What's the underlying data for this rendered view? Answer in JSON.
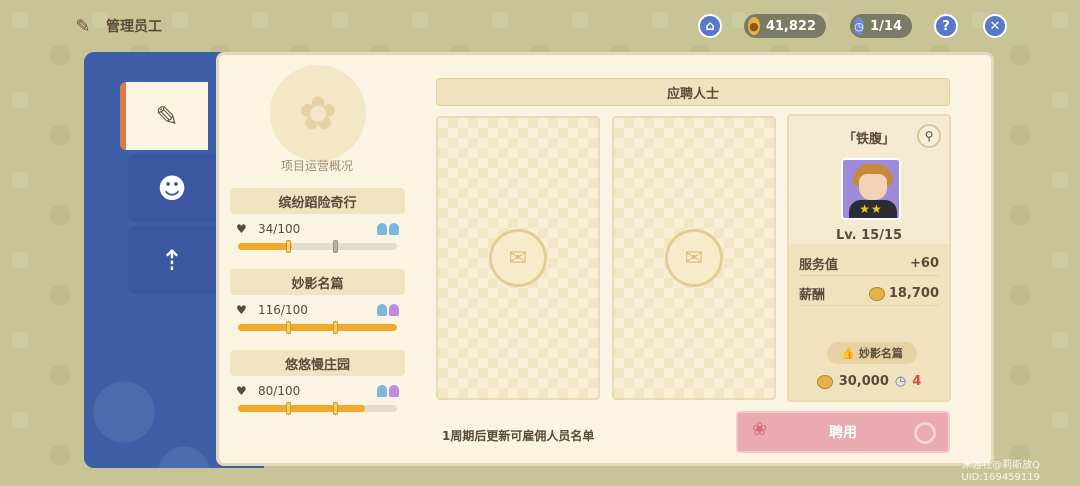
{
  "header": {
    "title": "管理员工",
    "coins": "41,822",
    "count": "1/14",
    "help_icon": "question-icon",
    "close_icon": "close-icon"
  },
  "sidebar": {
    "tabs": [
      "manage-icon",
      "staff-icon",
      "upgrade-icon"
    ]
  },
  "overview": {
    "label": "项目运营概况",
    "projects": [
      {
        "title": "缤纷蹈险奇行",
        "value": "34/100",
        "progress": 0.34
      },
      {
        "title": "妙影名篇",
        "value": "116/100",
        "progress": 1.0
      },
      {
        "title": "悠悠慢庄园",
        "value": "80/100",
        "progress": 0.8
      }
    ]
  },
  "applicants": {
    "banner": "应聘人士",
    "footer": "1周期后更新可雇佣人员名单",
    "hire_label": "聘用"
  },
  "candidate": {
    "name": "「铁腹」",
    "level": "Lv. 15/15",
    "stars": "★★",
    "service_label": "服务值",
    "service_value": "+60",
    "salary_label": "薪酬",
    "salary_value": "18,700",
    "tag": "妙影名篇",
    "cost": "30,000",
    "cost_count": "4"
  },
  "watermark": {
    "line1": "米游社@莉斯放Q",
    "line2": "UID:169459119"
  },
  "colors": {
    "background": "#c7c596",
    "panel": "#fbf4e2",
    "frame_blue": "#3e5fa8",
    "progress": "#f0a928",
    "hire_button": "#e9aab0"
  }
}
